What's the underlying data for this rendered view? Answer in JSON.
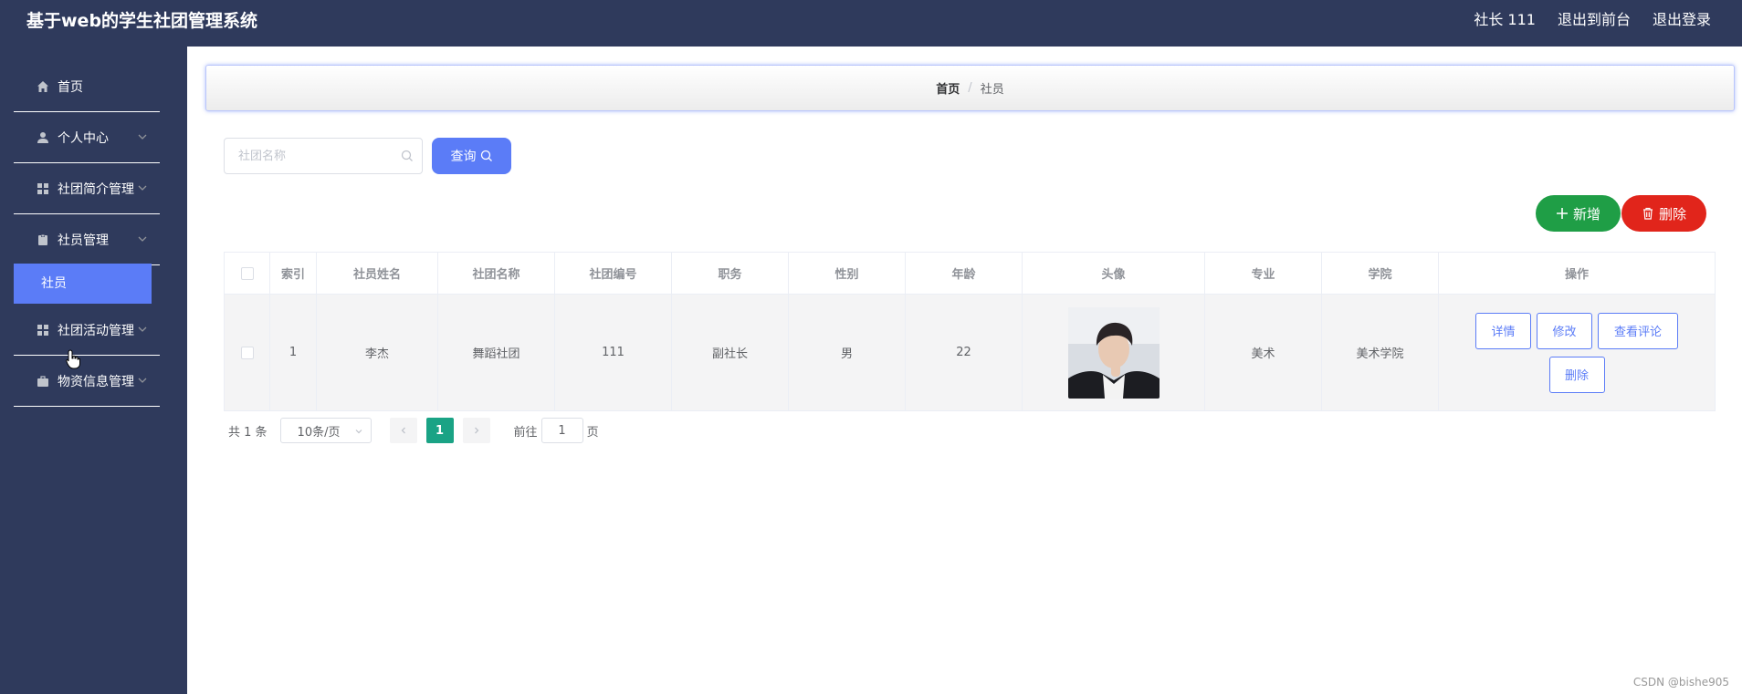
{
  "header": {
    "title": "基于web的学生社团管理系统",
    "user": "社长 111",
    "back_front": "退出到前台",
    "logout": "退出登录"
  },
  "sidebar": {
    "items": [
      {
        "label": "首页",
        "icon": "home-icon"
      },
      {
        "label": "个人中心",
        "icon": "user-icon"
      },
      {
        "label": "社团简介管理",
        "icon": "grid-icon"
      },
      {
        "label": "社员管理",
        "icon": "clipboard-icon"
      },
      {
        "label": "社团活动管理",
        "icon": "grid-icon"
      },
      {
        "label": "物资信息管理",
        "icon": "briefcase-icon"
      }
    ],
    "active_sub": "社员"
  },
  "breadcrumb": {
    "home": "首页",
    "current": "社员"
  },
  "search": {
    "placeholder": "社团名称",
    "value": "",
    "query_label": "查询"
  },
  "actions": {
    "add_label": "新增",
    "delete_label": "删除"
  },
  "table": {
    "headers": [
      "索引",
      "社员姓名",
      "社团名称",
      "社团编号",
      "职务",
      "性别",
      "年龄",
      "头像",
      "专业",
      "学院",
      "操作"
    ],
    "rows": [
      {
        "index": "1",
        "name": "李杰",
        "club": "舞蹈社团",
        "club_no": "111",
        "position": "副社长",
        "gender": "男",
        "age": "22",
        "major": "美术",
        "college": "美术学院"
      }
    ],
    "row_actions": [
      "详情",
      "修改",
      "查看评论",
      "删除"
    ]
  },
  "pagination": {
    "total": "共 1 条",
    "page_size": "10条/页",
    "current_page": "1",
    "goto_prefix": "前往",
    "goto_value": "1",
    "goto_suffix": "页"
  },
  "watermark": "CSDN @bishe905",
  "colors": {
    "header_bg": "#2f3a5c",
    "accent": "#5b7cf7",
    "add_green": "#1f9e46",
    "delete_red": "#e1251b",
    "page_active": "#1aa385"
  }
}
